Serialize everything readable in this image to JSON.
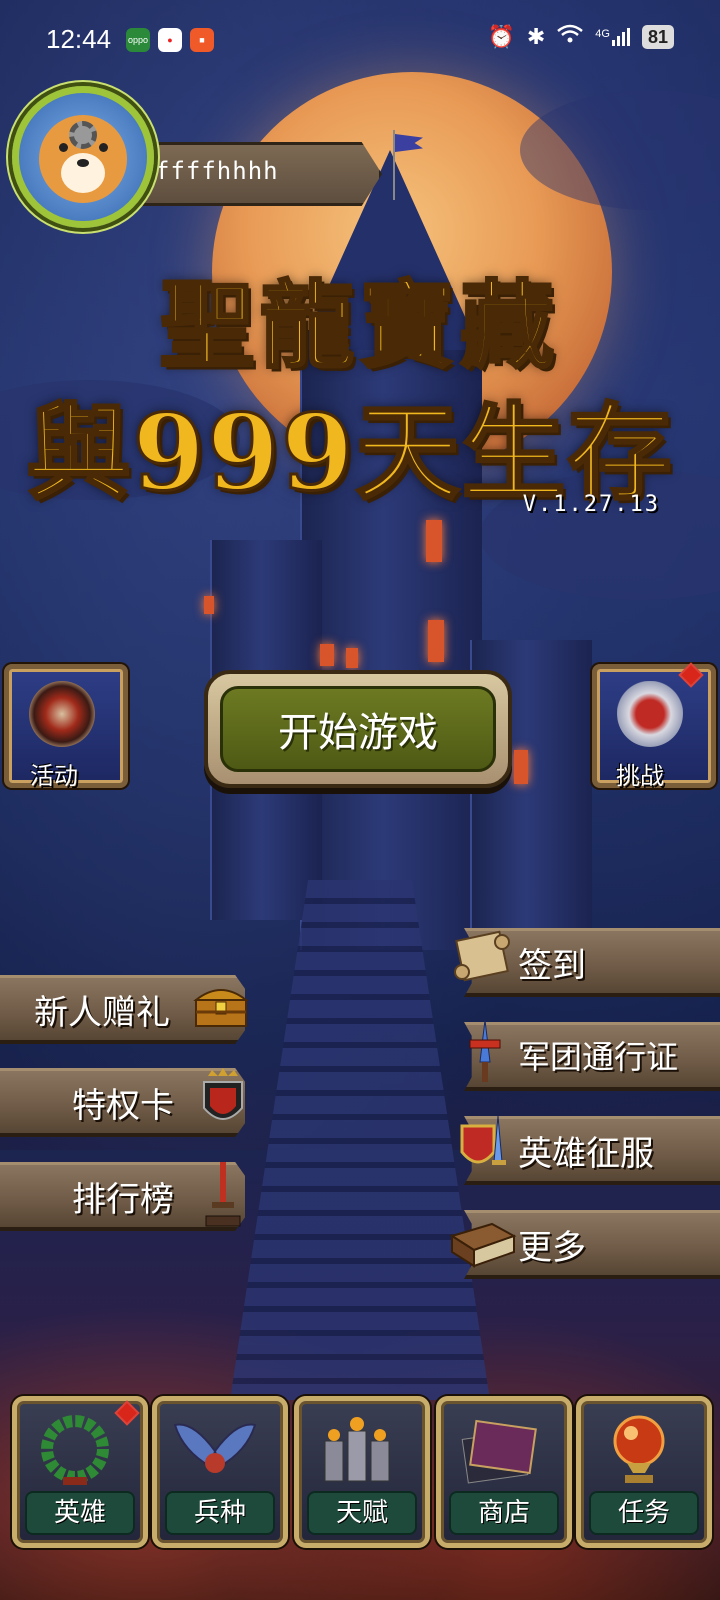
{
  "status_bar": {
    "time": "12:44",
    "notif_icons": [
      "oppo-app-icon",
      "red-app-icon",
      "orange-app-icon"
    ],
    "right_icons": [
      "alarm-icon",
      "bluetooth-icon",
      "wifi-icon",
      "4g-signal-icon"
    ],
    "network_label": "4G",
    "battery": "81"
  },
  "profile": {
    "username": "ffffhhhh"
  },
  "title": {
    "line1": "聖龍寶藏",
    "line2": "與999天生存"
  },
  "version": "V.1.27.13",
  "side_buttons": {
    "left_label": "活动",
    "right_label": "挑战"
  },
  "start_button": "开始游戏",
  "left_menu": [
    {
      "label": "新人赠礼",
      "icon": "treasure-chest-icon"
    },
    {
      "label": "特权卡",
      "icon": "crest-shield-icon"
    },
    {
      "label": "排行榜",
      "icon": "dagger-icon"
    }
  ],
  "right_menu": [
    {
      "label": "签到",
      "icon": "scroll-icon"
    },
    {
      "label": "军团通行证",
      "icon": "sword-icon"
    },
    {
      "label": "英雄征服",
      "icon": "shield-sword-icon"
    },
    {
      "label": "更多",
      "icon": "book-icon"
    }
  ],
  "bottom_tabs": [
    {
      "label": "英雄",
      "icon": "laurel-wreath-icon",
      "badge": true
    },
    {
      "label": "兵种",
      "icon": "wings-icon",
      "badge": false
    },
    {
      "label": "天赋",
      "icon": "towers-icon",
      "badge": false
    },
    {
      "label": "商店",
      "icon": "cards-icon",
      "badge": false
    },
    {
      "label": "任务",
      "icon": "crystal-orb-icon",
      "badge": false
    }
  ],
  "colors": {
    "title_gold": "#f0b81e",
    "start_green": "#5e6a1a",
    "banner_wood": "#6e5a46",
    "tab_label_green": "#1e4a3c",
    "badge_red": "#d8261a"
  }
}
